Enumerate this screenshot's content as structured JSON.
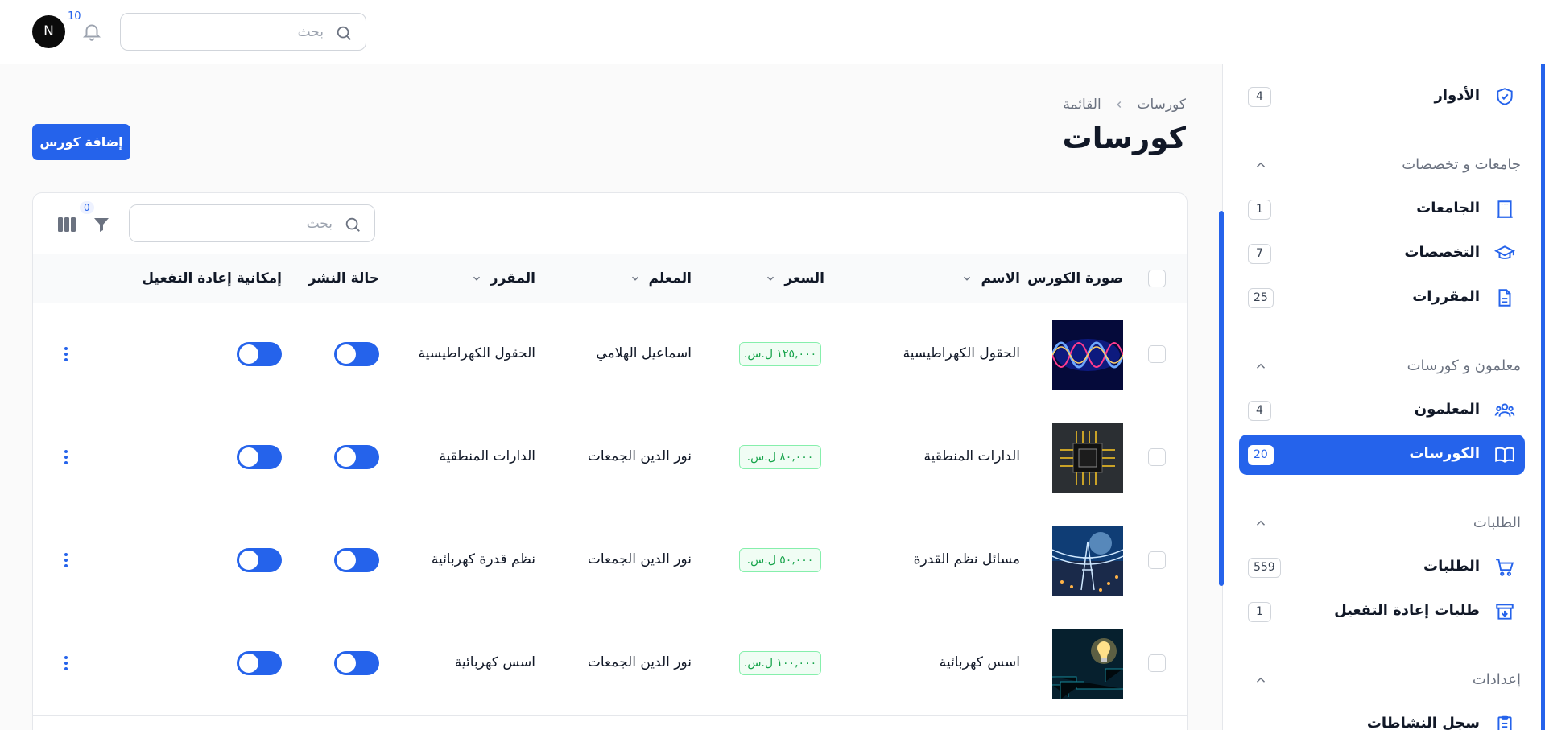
{
  "header": {
    "search_placeholder": "بحث",
    "notification_count": "10",
    "avatar_initial": "N"
  },
  "sidebar": {
    "top_item": {
      "label": "الأدوار",
      "count": "4",
      "icon": "shield-check-icon"
    },
    "groups": [
      {
        "title": "جامعات و تخصصات",
        "items": [
          {
            "label": "الجامعات",
            "count": "1",
            "icon": "building-icon"
          },
          {
            "label": "التخصصات",
            "count": "7",
            "icon": "graduation-cap-icon"
          },
          {
            "label": "المقررات",
            "count": "25",
            "icon": "document-icon"
          }
        ]
      },
      {
        "title": "معلمون و كورسات",
        "items": [
          {
            "label": "المعلمون",
            "count": "4",
            "icon": "users-icon"
          },
          {
            "label": "الكورسات",
            "count": "20",
            "icon": "book-open-icon",
            "active": true
          }
        ]
      },
      {
        "title": "الطلبات",
        "items": [
          {
            "label": "الطلبات",
            "count": "559",
            "icon": "cart-icon"
          },
          {
            "label": "طلبات إعادة التفعيل",
            "count": "1",
            "icon": "archive-download-icon"
          }
        ]
      },
      {
        "title": "إعدادات",
        "items": [
          {
            "label": "سجل النشاطات",
            "icon": "clipboard-icon"
          }
        ]
      }
    ]
  },
  "page": {
    "breadcrumb": [
      "كورسات",
      "القائمة"
    ],
    "title": "كورسات",
    "add_button": "إضافة كورس"
  },
  "table": {
    "search_placeholder": "بحث",
    "filter_count": "0",
    "columns": {
      "image": "صورة الكورس",
      "name": "الاسم",
      "price": "السعر",
      "teacher": "المعلم",
      "subject": "المقرر",
      "published": "حالة النشر",
      "reactivation": "إمكانية إعادة التفعيل"
    },
    "rows": [
      {
        "name": "الحقول الكهراطيسية",
        "price": "١٢٥,٠٠٠ ل.س.",
        "teacher": "اسماعيل الهلامي",
        "subject": "الحقول الكهراطيسية",
        "published": true,
        "reactivation": true,
        "image": "wave"
      },
      {
        "name": "الدارات المنطقية",
        "price": "٨٠,٠٠٠ ل.س.",
        "teacher": "نور الدين الجمعات",
        "subject": "الدارات المنطقية",
        "published": true,
        "reactivation": true,
        "image": "chip"
      },
      {
        "name": "مسائل نظم القدرة",
        "price": "٥٠,٠٠٠ ل.س.",
        "teacher": "نور الدين الجمعات",
        "subject": "نظم قدرة كهربائية",
        "published": true,
        "reactivation": true,
        "image": "grid"
      },
      {
        "name": "اسس كهربائية",
        "price": "١٠٠,٠٠٠ ل.س.",
        "teacher": "نور الدين الجمعات",
        "subject": "اسس كهربائية",
        "published": true,
        "reactivation": true,
        "image": "bulb"
      }
    ]
  }
}
